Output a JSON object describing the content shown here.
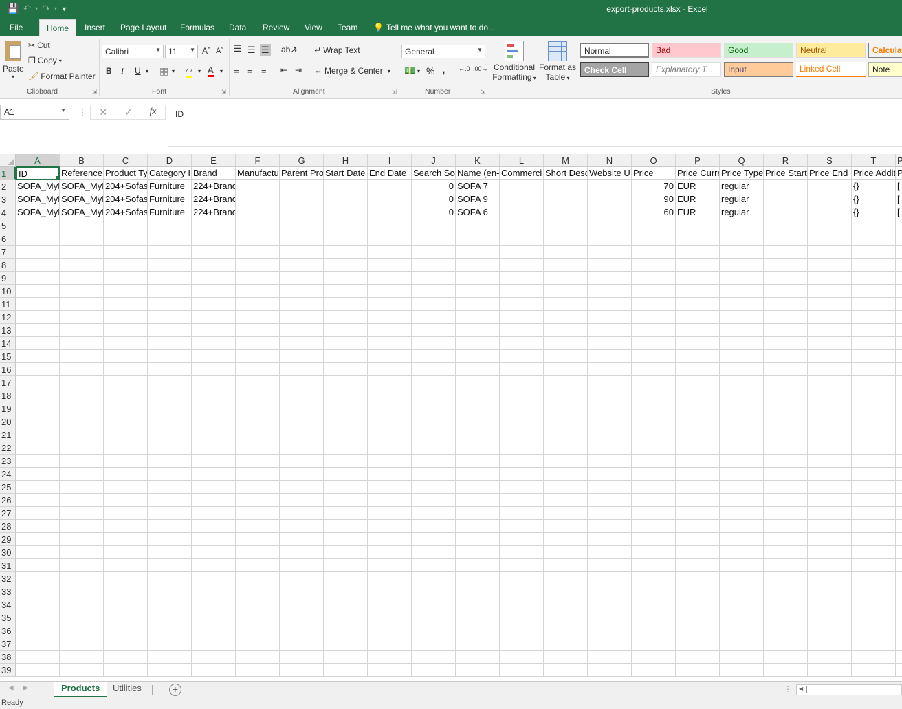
{
  "window": {
    "title": "export-products.xlsx - Excel"
  },
  "qat": {
    "save_icon": "save-icon",
    "undo_icon": "undo-icon",
    "redo_icon": "redo-icon"
  },
  "tabs": {
    "file": "File",
    "home": "Home",
    "insert": "Insert",
    "page_layout": "Page Layout",
    "formulas": "Formulas",
    "data": "Data",
    "review": "Review",
    "view": "View",
    "team": "Team",
    "tell_me": "Tell me what you want to do..."
  },
  "ribbon": {
    "clipboard": {
      "paste": "Paste",
      "cut": "Cut",
      "copy": "Copy",
      "format_painter": "Format Painter",
      "label": "Clipboard"
    },
    "font": {
      "name": "Calibri",
      "size": "11",
      "bold": "B",
      "italic": "I",
      "underline": "U",
      "label": "Font"
    },
    "alignment": {
      "wrap_text": "Wrap Text",
      "merge_center": "Merge & Center",
      "label": "Alignment"
    },
    "number": {
      "format": "General",
      "percent": "%",
      "comma": ",",
      "label": "Number"
    },
    "conditional": {
      "line1": "Conditional",
      "line2": "Formatting"
    },
    "format_table": {
      "line1": "Format as",
      "line2": "Table"
    },
    "styles": {
      "label": "Styles",
      "items": [
        {
          "label": "Normal",
          "bg": "#ffffff",
          "fg": "#222222"
        },
        {
          "label": "Bad",
          "bg": "#ffc7ce",
          "fg": "#9c0006"
        },
        {
          "label": "Good",
          "bg": "#c6efce",
          "fg": "#006100"
        },
        {
          "label": "Neutral",
          "bg": "#ffeb9c",
          "fg": "#9c5700"
        },
        {
          "label": "Calculat",
          "bg": "#f2f2f2",
          "fg": "#fa7d00"
        },
        {
          "label": "Check Cell",
          "bg": "#a5a5a5",
          "fg": "#ffffff"
        },
        {
          "label": "Explanatory T...",
          "bg": "#ffffff",
          "fg": "#7f7f7f"
        },
        {
          "label": "Input",
          "bg": "#ffcc99",
          "fg": "#3f3f76"
        },
        {
          "label": "Linked Cell",
          "bg": "#ffffff",
          "fg": "#fa7d00"
        },
        {
          "label": "Note",
          "bg": "#ffffcc",
          "fg": "#222222"
        }
      ]
    }
  },
  "formula_bar": {
    "name_box": "A1",
    "content": "ID"
  },
  "sheet": {
    "columns": [
      "A",
      "B",
      "C",
      "D",
      "E",
      "F",
      "G",
      "H",
      "I",
      "J",
      "K",
      "L",
      "M",
      "N",
      "O",
      "P",
      "Q",
      "R",
      "S",
      "T"
    ],
    "headers": [
      "ID",
      "Reference",
      "Product Ty",
      "Category I",
      "Brand",
      "Manufactu",
      "Parent Pro",
      "Start Date",
      "End Date",
      "Search Sco",
      "Name (en-",
      "Commerci",
      "Short Desc",
      "Website U",
      "Price",
      "Price Curre",
      "Price Type",
      "Price Start",
      "Price End D",
      "Price Addit"
    ],
    "rows": [
      [
        "SOFA_MyN",
        "SOFA_MyN",
        "204+Sofas",
        "Furniture",
        "224+Branc",
        "",
        "",
        "",
        "",
        "0",
        "SOFA 7",
        "",
        "",
        "",
        "70",
        "EUR",
        "regular",
        "",
        "",
        "{}"
      ],
      [
        "SOFA_MyN",
        "SOFA_MyN",
        "204+Sofas",
        "Furniture",
        "224+Branc",
        "",
        "",
        "",
        "",
        "0",
        "SOFA 9",
        "",
        "",
        "",
        "90",
        "EUR",
        "regular",
        "",
        "",
        "{}"
      ],
      [
        "SOFA_MyN",
        "SOFA_MyN",
        "204+Sofas",
        "Furniture",
        "224+Branc",
        "",
        "",
        "",
        "",
        "0",
        "SOFA 6",
        "",
        "",
        "",
        "60",
        "EUR",
        "regular",
        "",
        "",
        "{}"
      ]
    ],
    "overflow_col_header": "P",
    "overflow_row1": "P",
    "overflow_rows": [
      "[",
      "[",
      "["
    ],
    "row_numbers": [
      "1",
      "2",
      "3",
      "4",
      "5",
      "6",
      "7",
      "8",
      "9",
      "10",
      "11",
      "12",
      "13",
      "14",
      "15",
      "16",
      "17",
      "18",
      "19",
      "20",
      "21",
      "22",
      "23",
      "24",
      "25",
      "26",
      "27",
      "28",
      "29",
      "30",
      "31",
      "32",
      "33",
      "34",
      "35",
      "36",
      "37",
      "38",
      "39"
    ]
  },
  "sheet_tabs": [
    "Products",
    "Utilities"
  ],
  "status": {
    "text": "Ready"
  }
}
